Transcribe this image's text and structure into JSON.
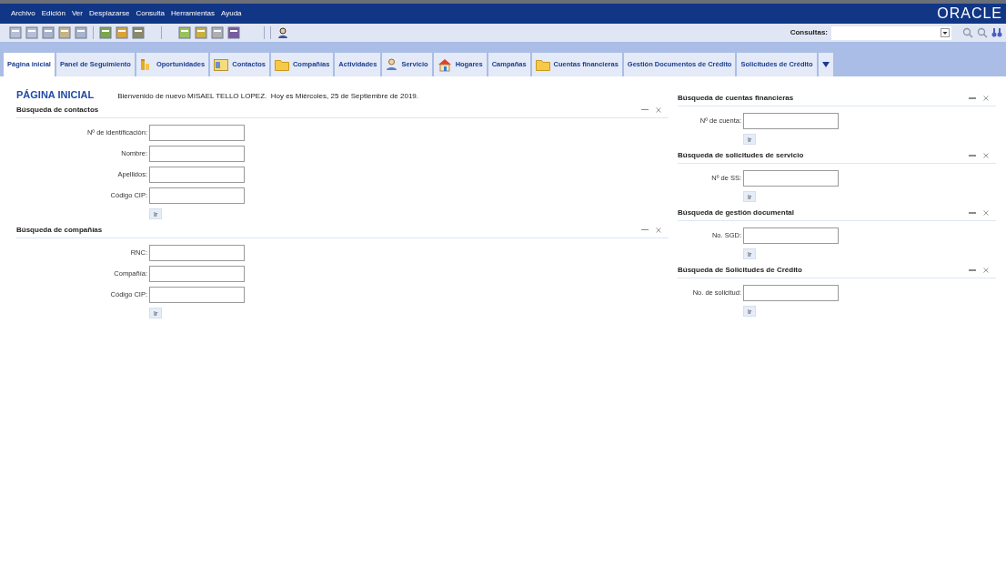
{
  "menu": [
    "Archivo",
    "Edición",
    "Ver",
    "Desplazarse",
    "Consulta",
    "Herramientas",
    "Ayuda"
  ],
  "logo": "ORACLE",
  "queries": {
    "label": "Consultas:"
  },
  "tabs": [
    {
      "label": "Página inicial",
      "selected": true,
      "kind": "plain"
    },
    {
      "label": "Panel de Seguimiento",
      "selected": false,
      "kind": "plain"
    },
    {
      "label": "Oportunidades",
      "selected": false,
      "kind": "chart"
    },
    {
      "label": "Contactos",
      "selected": false,
      "kind": "card"
    },
    {
      "label": "Compañías",
      "selected": false,
      "kind": "folder"
    },
    {
      "label": "Actividades",
      "selected": false,
      "kind": "plain"
    },
    {
      "label": "Servicio",
      "selected": false,
      "kind": "person"
    },
    {
      "label": "Hogares",
      "selected": false,
      "kind": "house"
    },
    {
      "label": "Campañas",
      "selected": false,
      "kind": "plain"
    },
    {
      "label": "Cuentas financieras",
      "selected": false,
      "kind": "folder"
    },
    {
      "label": "Gestión Documentos de Crédito",
      "selected": false,
      "kind": "plain"
    },
    {
      "label": "Solicitudes de Crédito",
      "selected": false,
      "kind": "plain"
    }
  ],
  "page_title": "PÁGINA INICIAL",
  "welcome": "Bienvenido de nuevo MISAEL TELLO LOPEZ.  Hoy es Miércoles, 25 de Septiembre de 2019.",
  "left_sections": [
    {
      "title": "Búsqueda de contactos",
      "fields": [
        "Nº de identificación:",
        "Nombre:",
        "Apellidos:",
        "Código CIP:"
      ],
      "button": "Ir"
    },
    {
      "title": "Búsqueda de compañías",
      "fields": [
        "RNC:",
        "Compañía:",
        "Código CIP:"
      ],
      "button": "Ir"
    }
  ],
  "right_sections": [
    {
      "title": "Búsqueda de cuentas financieras",
      "fields": [
        "Nº de cuenta:"
      ],
      "button": "Ir"
    },
    {
      "title": "Búsqueda de solicitudes de servicio",
      "fields": [
        "Nº de SS:"
      ],
      "button": "Ir"
    },
    {
      "title": "Búsqueda de gestión documental",
      "fields": [
        "No. SGD:"
      ],
      "button": "Ir"
    },
    {
      "title": "Búsqueda de Solicitudes de Crédito",
      "fields": [
        "No. de solicitud:"
      ],
      "button": "Ir"
    }
  ]
}
